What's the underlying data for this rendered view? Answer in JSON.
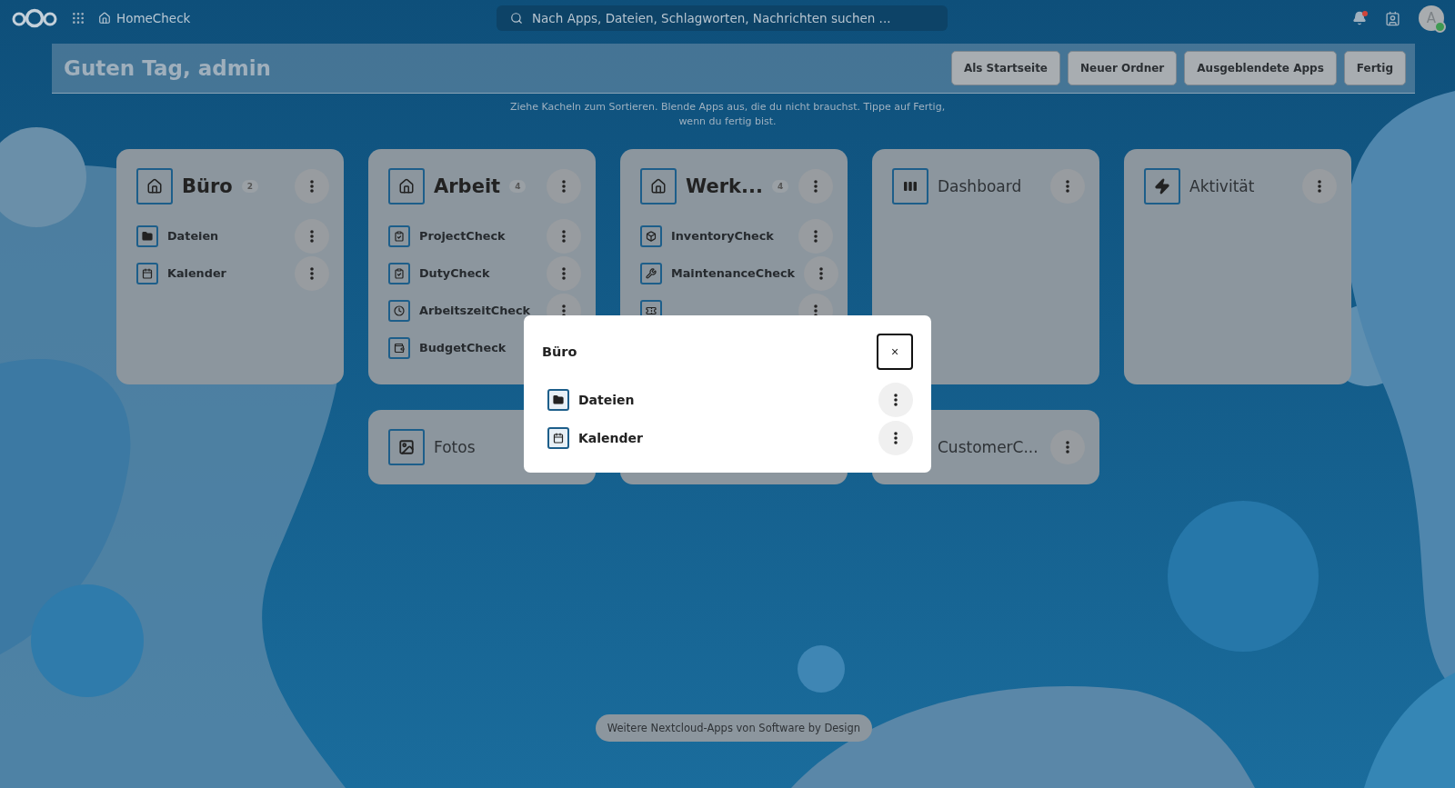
{
  "top_bar": {
    "app_name": "HomeCheck",
    "search": {
      "placeholder": "Nach Apps, Dateien, Schlagworten, Nachrichten suchen ..."
    },
    "notifications": {
      "unread": true
    },
    "avatar": {
      "initial": "A",
      "online": true
    }
  },
  "header": {
    "greeting": "Guten Tag, admin",
    "buttons": [
      "Als Startseite",
      "Neuer Ordner",
      "Ausgeblendete Apps",
      "Fertig"
    ]
  },
  "hint": "Ziehe Kacheln zum Sortieren. Blende Apps aus, die du nicht brauchst. Tippe auf Fertig, wenn du fertig bist.",
  "tiles": [
    {
      "kind": "folder",
      "title": "Büro",
      "count": "2",
      "items": [
        {
          "name": "Dateien"
        },
        {
          "name": "Kalender"
        }
      ]
    },
    {
      "kind": "folder",
      "title": "Arbeit",
      "count": "4",
      "items": [
        {
          "name": "ProjectCheck"
        },
        {
          "name": "DutyCheck"
        },
        {
          "name": "ArbeitszeitCheck"
        },
        {
          "name": "BudgetCheck"
        }
      ]
    },
    {
      "kind": "folder",
      "title": "Werk...",
      "count": "4",
      "items": [
        {
          "kind": "app",
          "name": "InventoryCheck"
        },
        {
          "kind": "app",
          "name": "MaintenanceCheck"
        },
        {
          "kind": "covered"
        }
      ]
    },
    {
      "kind": "app",
      "title": "Dashboard"
    },
    {
      "kind": "app",
      "title": "Aktivität"
    },
    {
      "kind": "app",
      "title": "Fotos"
    },
    {
      "kind": "covered"
    },
    {
      "kind": "app",
      "title": "CustomerC..."
    }
  ],
  "dialog": {
    "title": "Büro",
    "close": "×",
    "items": [
      {
        "name": "Dateien"
      },
      {
        "name": "Kalender"
      }
    ]
  },
  "footer": "Weitere Nextcloud-Apps von Software by Design"
}
